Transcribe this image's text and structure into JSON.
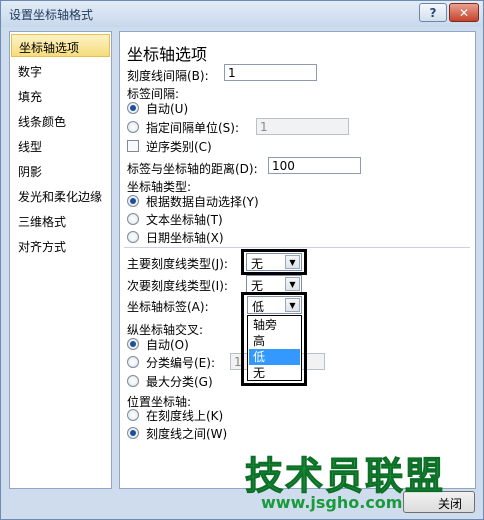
{
  "window": {
    "title": "设置坐标轴格式",
    "help": "?",
    "close": "✕"
  },
  "nav": {
    "items": [
      {
        "label": "坐标轴选项",
        "active": true
      },
      {
        "label": "数字"
      },
      {
        "label": "填充"
      },
      {
        "label": "线条颜色"
      },
      {
        "label": "线型"
      },
      {
        "label": "阴影"
      },
      {
        "label": "发光和柔化边缘"
      },
      {
        "label": "三维格式"
      },
      {
        "label": "对齐方式"
      }
    ]
  },
  "panel": {
    "title": "坐标轴选项",
    "tick_interval_label": "刻度线间隔(B):",
    "tick_interval_value": "1",
    "label_interval_label": "标签间隔:",
    "auto_label": "自动(U)",
    "specify_label": "指定间隔单位(S):",
    "specify_value": "1",
    "reverse_label": "逆序类别(C)",
    "distance_label": "标签与坐标轴的距离(D):",
    "distance_value": "100",
    "axis_type_label": "坐标轴类型:",
    "axis_auto_label": "根据数据自动选择(Y)",
    "axis_text_label": "文本坐标轴(T)",
    "axis_date_label": "日期坐标轴(X)",
    "major_tick_label": "主要刻度线类型(J):",
    "major_tick_value": "无",
    "minor_tick_label": "次要刻度线类型(I):",
    "minor_tick_value": "无",
    "axis_labels_label": "坐标轴标签(A):",
    "axis_labels_value": "低",
    "dropdown_options": [
      "轴旁",
      "高",
      "低",
      "无"
    ],
    "cross_label": "纵坐标轴交叉:",
    "cross_auto_label": "自动(O)",
    "cross_category_label": "分类编号(E):",
    "cross_category_value": "1",
    "cross_max_label": "最大分类(G)",
    "position_label": "位置坐标轴:",
    "position_on_label": "在刻度线上(K)",
    "position_between_label": "刻度线之间(W)"
  },
  "footer": {
    "close_label": "关闭"
  },
  "watermark": {
    "title": "技术员联盟",
    "url": "www.jsgho.com"
  },
  "icons": {
    "dropdown_arrow": "chevron-down-icon"
  },
  "colors": {
    "accent": "#1c4f9c",
    "highlight": "#3399ff",
    "watermark": "#1a9a3b"
  }
}
